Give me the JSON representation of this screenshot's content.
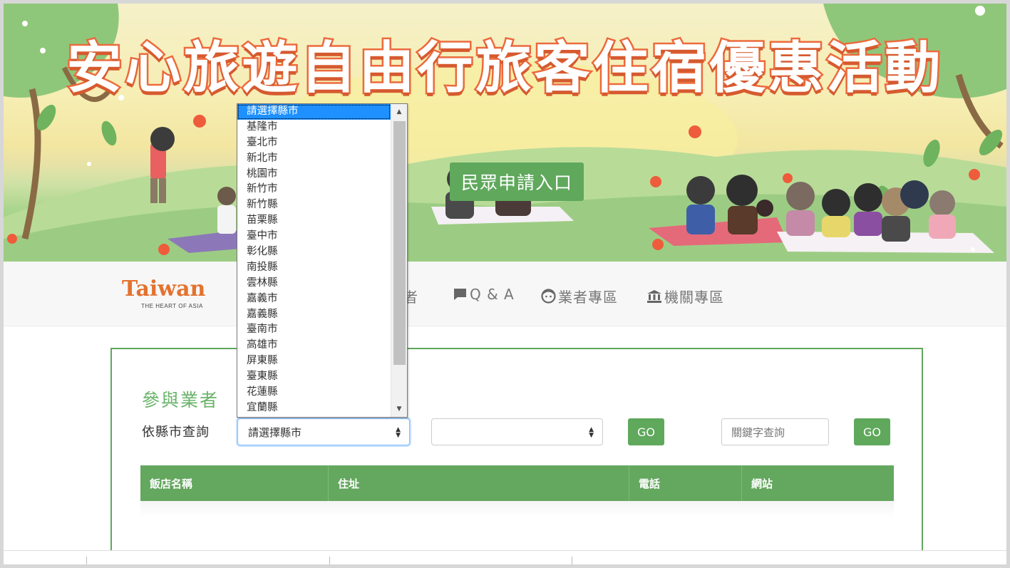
{
  "banner": {
    "title": "安心旅遊自由行旅客住宿優惠活動",
    "apply_button": "民眾申請入口"
  },
  "navbar": {
    "logo_word": "Taiwan",
    "logo_sub": "THE HEART OF ASIA",
    "items": [
      {
        "label": "參與業者",
        "icon": "list-icon"
      },
      {
        "label": "Q & A",
        "icon": "comment-icon"
      },
      {
        "label": "業者專區",
        "icon": "face-icon"
      },
      {
        "label": "機關專區",
        "icon": "bank-icon"
      }
    ]
  },
  "section": {
    "title": "參與業者",
    "filter_label": "依縣市查詢",
    "city_select_value": "請選擇縣市",
    "district_select_value": "",
    "go_label": "GO",
    "keyword_placeholder": "關鍵字查詢",
    "go2_label": "GO"
  },
  "table": {
    "columns": [
      "飯店名稱",
      "住址",
      "電話",
      "網站"
    ]
  },
  "dropdown": {
    "selected": "請選擇縣市",
    "options": [
      "請選擇縣市",
      "基隆市",
      "臺北市",
      "新北市",
      "桃園市",
      "新竹市",
      "新竹縣",
      "苗栗縣",
      "臺中市",
      "彰化縣",
      "南投縣",
      "雲林縣",
      "嘉義市",
      "嘉義縣",
      "臺南市",
      "高雄市",
      "屏東縣",
      "臺東縣",
      "花蓮縣",
      "宜蘭縣"
    ]
  },
  "colors": {
    "brand_green": "#5fa85c",
    "title_orange": "#ec6a3c",
    "select_highlight": "#1e90ff"
  }
}
